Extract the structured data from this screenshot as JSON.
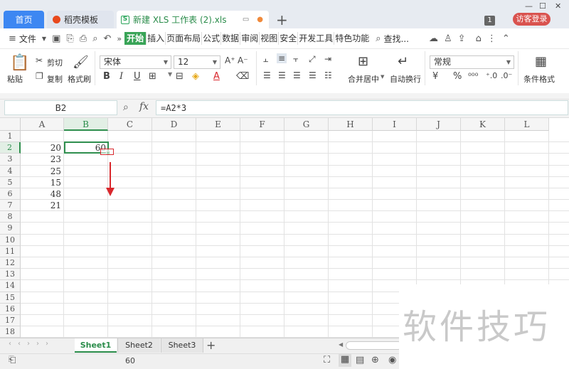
{
  "tabs": {
    "home": "首页",
    "template": "稻壳模板",
    "file": "新建 XLS 工作表 (2).xls",
    "file_logo": "S",
    "add": "+"
  },
  "window": {
    "badge": "1",
    "login": "访客登录"
  },
  "menu": {
    "file": "文件",
    "items": [
      "开始",
      "插入",
      "页面布局",
      "公式",
      "数据",
      "审阅",
      "视图",
      "安全",
      "开发工具",
      "特色功能"
    ],
    "search": "查找..."
  },
  "toolbar": {
    "paste": "粘贴",
    "cut": "剪切",
    "copy": "复制",
    "format_painter": "格式刷",
    "font_name": "宋体",
    "font_size": "12",
    "merge": "合并居中",
    "wrap": "自动换行",
    "number_format": "常规",
    "conditional_format": "条件格式"
  },
  "formula_bar": {
    "name_box": "B2",
    "fx": "fx",
    "formula": "=A2*3"
  },
  "grid": {
    "columns": [
      "A",
      "B",
      "C",
      "D",
      "E",
      "F",
      "G",
      "H",
      "I",
      "J",
      "K",
      "L"
    ],
    "rows": [
      "1",
      "2",
      "3",
      "4",
      "5",
      "6",
      "7",
      "8",
      "9",
      "10",
      "11",
      "12",
      "13",
      "14",
      "15",
      "16",
      "17",
      "18"
    ],
    "a_values": [
      "20",
      "23",
      "25",
      "15",
      "48",
      "21"
    ],
    "b2": "60"
  },
  "sheets": [
    "Sheet1",
    "Sheet2",
    "Sheet3"
  ],
  "status": {
    "value": "60"
  },
  "watermark": "软件技巧",
  "colors": {
    "accent_green": "#39a457",
    "arrow_red": "#d9282d",
    "home_tab_blue": "#3d87f2"
  }
}
